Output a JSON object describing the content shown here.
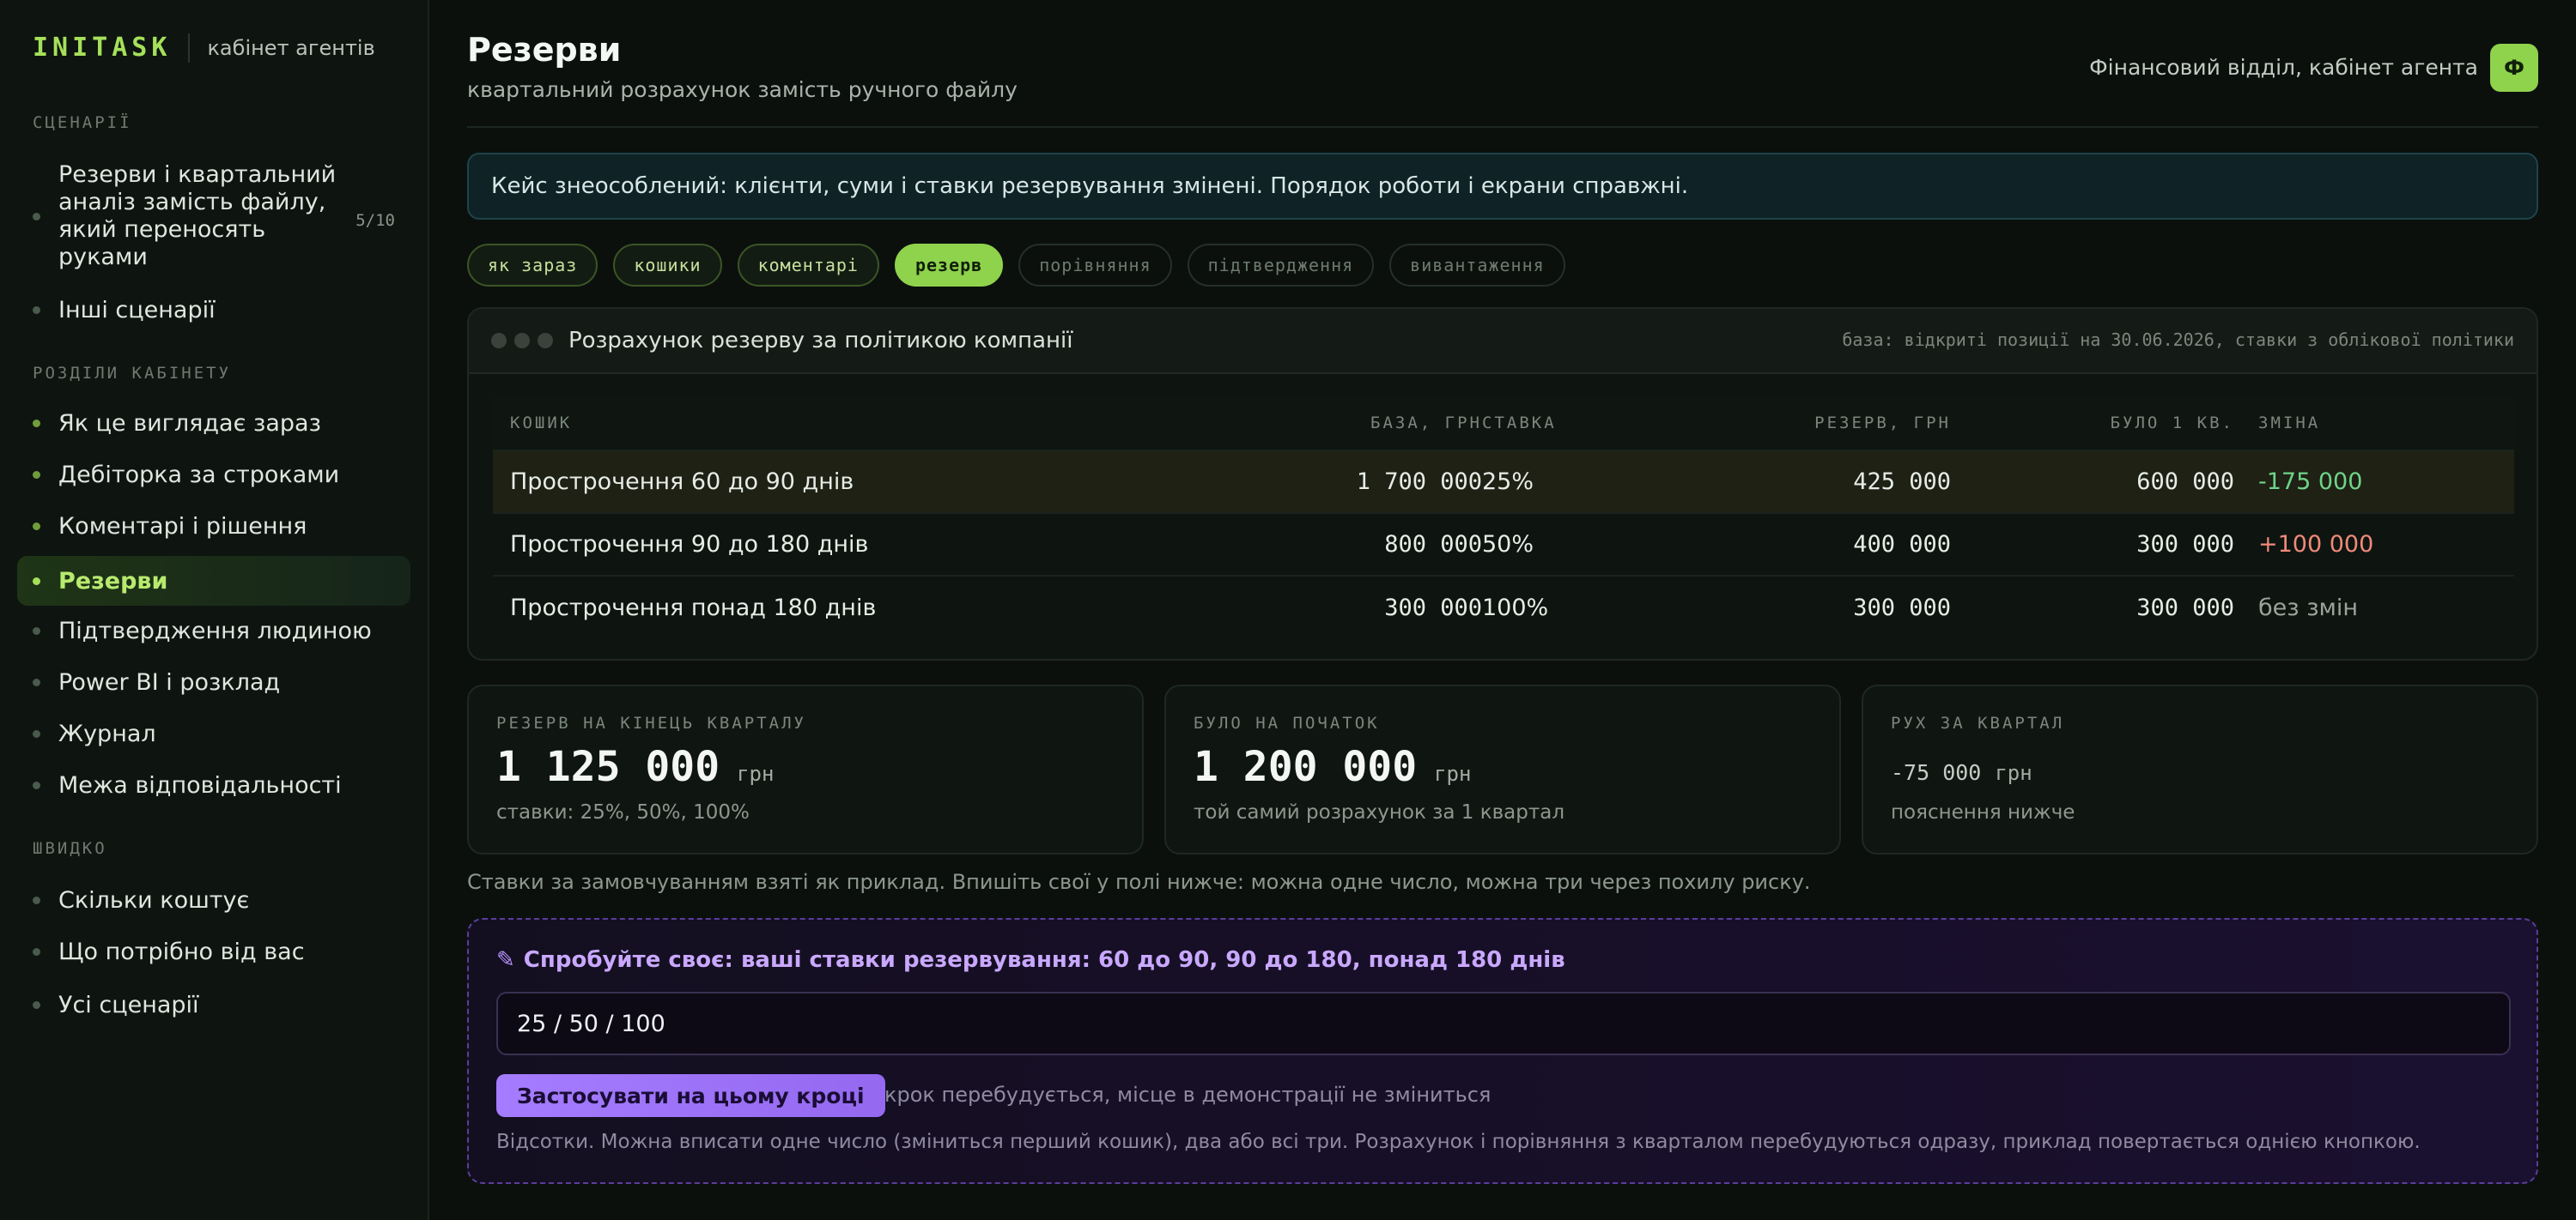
{
  "brand": {
    "logo": "INITASK",
    "subtitle": "кабінет агентів"
  },
  "sidebar": {
    "scenarios_label": "СЦЕНАРІЇ",
    "scenarios": [
      {
        "label": "Резерви і квартальний аналіз замість файлу, який переносять руками",
        "count": "5/10"
      },
      {
        "label": "Інші сценарії"
      }
    ],
    "sections_label": "РОЗДІЛИ КАБІНЕТУ",
    "sections": [
      {
        "label": "Як це виглядає зараз"
      },
      {
        "label": "Дебіторка за строками"
      },
      {
        "label": "Коментарі і рішення"
      },
      {
        "label": "Резерви",
        "active": true
      },
      {
        "label": "Підтвердження людиною"
      },
      {
        "label": "Power BI і розклад"
      },
      {
        "label": "Журнал"
      },
      {
        "label": "Межа відповідальності"
      }
    ],
    "quick_label": "ШВИДКО",
    "quick": [
      {
        "label": "Скільки коштує"
      },
      {
        "label": "Що потрібно від вас"
      },
      {
        "label": "Усі сценарії"
      }
    ]
  },
  "header": {
    "title": "Резерви",
    "subtitle": "квартальний розрахунок замість ручного файлу",
    "user_label": "Фінансовий відділ, кабінет агента",
    "avatar": "Ф"
  },
  "notice": "Кейс знеособлений: клієнти, суми і ставки резервування змінені. Порядок роботи і екрани справжні.",
  "steps": [
    {
      "label": "як зараз",
      "state": "done"
    },
    {
      "label": "кошики",
      "state": "done"
    },
    {
      "label": "коментарі",
      "state": "done"
    },
    {
      "label": "резерв",
      "state": "active"
    },
    {
      "label": "порівняння",
      "state": "todo"
    },
    {
      "label": "підтвердження",
      "state": "todo"
    },
    {
      "label": "вивантаження",
      "state": "todo"
    }
  ],
  "calc": {
    "title": "Розрахунок резерву за політикою компанії",
    "meta": "база: відкриті позиції на 30.06.2026, ставки з облікової політики",
    "columns": [
      "КОШИК",
      "БАЗА, ГРН",
      "СТАВКА",
      "РЕЗЕРВ, ГРН",
      "БУЛО 1 КВ.",
      "ЗМІНА"
    ],
    "rows": [
      {
        "bucket": "Прострочення 60 до 90 днів",
        "base": "1 700 000",
        "rate": "25%",
        "reserve": "425 000",
        "was": "600 000",
        "change": "-175 000"
      },
      {
        "bucket": "Прострочення 90 до 180 днів",
        "base": "800 000",
        "rate": "50%",
        "reserve": "400 000",
        "was": "300 000",
        "change": "+100 000"
      },
      {
        "bucket": "Прострочення понад 180 днів",
        "base": "300 000",
        "rate": "100%",
        "reserve": "300 000",
        "was": "300 000",
        "change": "без змін"
      }
    ]
  },
  "stats": [
    {
      "label": "РЕЗЕРВ НА КІНЕЦЬ КВАРТАЛУ",
      "value": "1 125 000",
      "unit": "грн",
      "note": "ставки: 25%, 50%, 100%"
    },
    {
      "label": "БУЛО НА ПОЧАТОК",
      "value": "1 200 000",
      "unit": "грн",
      "note": "той самий розрахунок за 1 квартал"
    },
    {
      "label": "РУХ ЗА КВАРТАЛ",
      "value": "-75 000",
      "unit": "грн",
      "note": "пояснення нижче"
    }
  ],
  "hint": "Ставки за замовчуванням взяті як приклад. Впишіть свої у полі нижче: можна одне число, можна три через похилу риску.",
  "try": {
    "pen": "✎",
    "title": "Спробуйте своє: ваші ставки резервування: 60 до 90, 90 до 180, понад 180 днів",
    "input_value": "25 / 50 / 100",
    "button": "Застосувати на цьому кроці",
    "button_note": "крок перебудується, місце в демонстрації не зміниться",
    "footnote": "Відсотки. Можна вписати одне число (зміниться перший кошик), два або всі три. Розрахунок і порівняння з кварталом перебудуються одразу, приклад повертається однією кнопкою."
  },
  "colors": {
    "accent": "#8fd24c",
    "positive": "#6fd38a",
    "negative": "#f08a7a",
    "try_accent": "#a57cff"
  }
}
